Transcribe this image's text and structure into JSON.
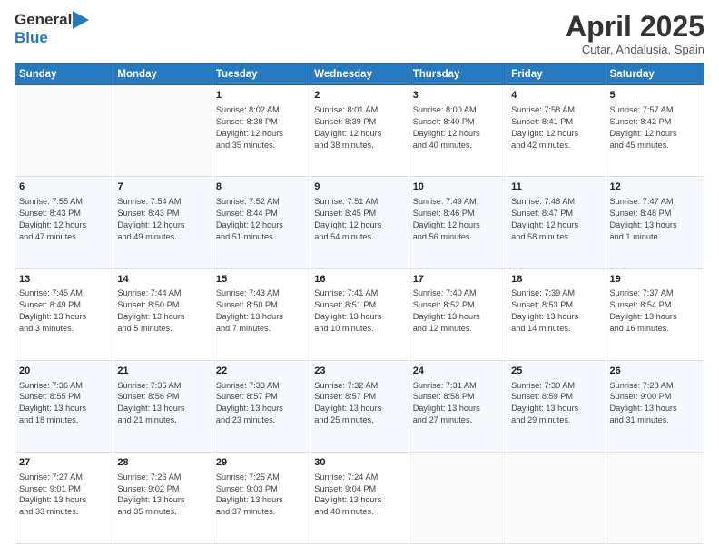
{
  "header": {
    "logo_general": "General",
    "logo_blue": "Blue",
    "title": "April 2025",
    "subtitle": "Cutar, Andalusia, Spain"
  },
  "calendar": {
    "days_of_week": [
      "Sunday",
      "Monday",
      "Tuesday",
      "Wednesday",
      "Thursday",
      "Friday",
      "Saturday"
    ],
    "weeks": [
      [
        {
          "num": "",
          "detail": ""
        },
        {
          "num": "",
          "detail": ""
        },
        {
          "num": "1",
          "detail": "Sunrise: 8:02 AM\nSunset: 8:38 PM\nDaylight: 12 hours\nand 35 minutes."
        },
        {
          "num": "2",
          "detail": "Sunrise: 8:01 AM\nSunset: 8:39 PM\nDaylight: 12 hours\nand 38 minutes."
        },
        {
          "num": "3",
          "detail": "Sunrise: 8:00 AM\nSunset: 8:40 PM\nDaylight: 12 hours\nand 40 minutes."
        },
        {
          "num": "4",
          "detail": "Sunrise: 7:58 AM\nSunset: 8:41 PM\nDaylight: 12 hours\nand 42 minutes."
        },
        {
          "num": "5",
          "detail": "Sunrise: 7:57 AM\nSunset: 8:42 PM\nDaylight: 12 hours\nand 45 minutes."
        }
      ],
      [
        {
          "num": "6",
          "detail": "Sunrise: 7:55 AM\nSunset: 8:43 PM\nDaylight: 12 hours\nand 47 minutes."
        },
        {
          "num": "7",
          "detail": "Sunrise: 7:54 AM\nSunset: 8:43 PM\nDaylight: 12 hours\nand 49 minutes."
        },
        {
          "num": "8",
          "detail": "Sunrise: 7:52 AM\nSunset: 8:44 PM\nDaylight: 12 hours\nand 51 minutes."
        },
        {
          "num": "9",
          "detail": "Sunrise: 7:51 AM\nSunset: 8:45 PM\nDaylight: 12 hours\nand 54 minutes."
        },
        {
          "num": "10",
          "detail": "Sunrise: 7:49 AM\nSunset: 8:46 PM\nDaylight: 12 hours\nand 56 minutes."
        },
        {
          "num": "11",
          "detail": "Sunrise: 7:48 AM\nSunset: 8:47 PM\nDaylight: 12 hours\nand 58 minutes."
        },
        {
          "num": "12",
          "detail": "Sunrise: 7:47 AM\nSunset: 8:48 PM\nDaylight: 13 hours\nand 1 minute."
        }
      ],
      [
        {
          "num": "13",
          "detail": "Sunrise: 7:45 AM\nSunset: 8:49 PM\nDaylight: 13 hours\nand 3 minutes."
        },
        {
          "num": "14",
          "detail": "Sunrise: 7:44 AM\nSunset: 8:50 PM\nDaylight: 13 hours\nand 5 minutes."
        },
        {
          "num": "15",
          "detail": "Sunrise: 7:43 AM\nSunset: 8:50 PM\nDaylight: 13 hours\nand 7 minutes."
        },
        {
          "num": "16",
          "detail": "Sunrise: 7:41 AM\nSunset: 8:51 PM\nDaylight: 13 hours\nand 10 minutes."
        },
        {
          "num": "17",
          "detail": "Sunrise: 7:40 AM\nSunset: 8:52 PM\nDaylight: 13 hours\nand 12 minutes."
        },
        {
          "num": "18",
          "detail": "Sunrise: 7:39 AM\nSunset: 8:53 PM\nDaylight: 13 hours\nand 14 minutes."
        },
        {
          "num": "19",
          "detail": "Sunrise: 7:37 AM\nSunset: 8:54 PM\nDaylight: 13 hours\nand 16 minutes."
        }
      ],
      [
        {
          "num": "20",
          "detail": "Sunrise: 7:36 AM\nSunset: 8:55 PM\nDaylight: 13 hours\nand 18 minutes."
        },
        {
          "num": "21",
          "detail": "Sunrise: 7:35 AM\nSunset: 8:56 PM\nDaylight: 13 hours\nand 21 minutes."
        },
        {
          "num": "22",
          "detail": "Sunrise: 7:33 AM\nSunset: 8:57 PM\nDaylight: 13 hours\nand 23 minutes."
        },
        {
          "num": "23",
          "detail": "Sunrise: 7:32 AM\nSunset: 8:57 PM\nDaylight: 13 hours\nand 25 minutes."
        },
        {
          "num": "24",
          "detail": "Sunrise: 7:31 AM\nSunset: 8:58 PM\nDaylight: 13 hours\nand 27 minutes."
        },
        {
          "num": "25",
          "detail": "Sunrise: 7:30 AM\nSunset: 8:59 PM\nDaylight: 13 hours\nand 29 minutes."
        },
        {
          "num": "26",
          "detail": "Sunrise: 7:28 AM\nSunset: 9:00 PM\nDaylight: 13 hours\nand 31 minutes."
        }
      ],
      [
        {
          "num": "27",
          "detail": "Sunrise: 7:27 AM\nSunset: 9:01 PM\nDaylight: 13 hours\nand 33 minutes."
        },
        {
          "num": "28",
          "detail": "Sunrise: 7:26 AM\nSunset: 9:02 PM\nDaylight: 13 hours\nand 35 minutes."
        },
        {
          "num": "29",
          "detail": "Sunrise: 7:25 AM\nSunset: 9:03 PM\nDaylight: 13 hours\nand 37 minutes."
        },
        {
          "num": "30",
          "detail": "Sunrise: 7:24 AM\nSunset: 9:04 PM\nDaylight: 13 hours\nand 40 minutes."
        },
        {
          "num": "",
          "detail": ""
        },
        {
          "num": "",
          "detail": ""
        },
        {
          "num": "",
          "detail": ""
        }
      ]
    ]
  }
}
